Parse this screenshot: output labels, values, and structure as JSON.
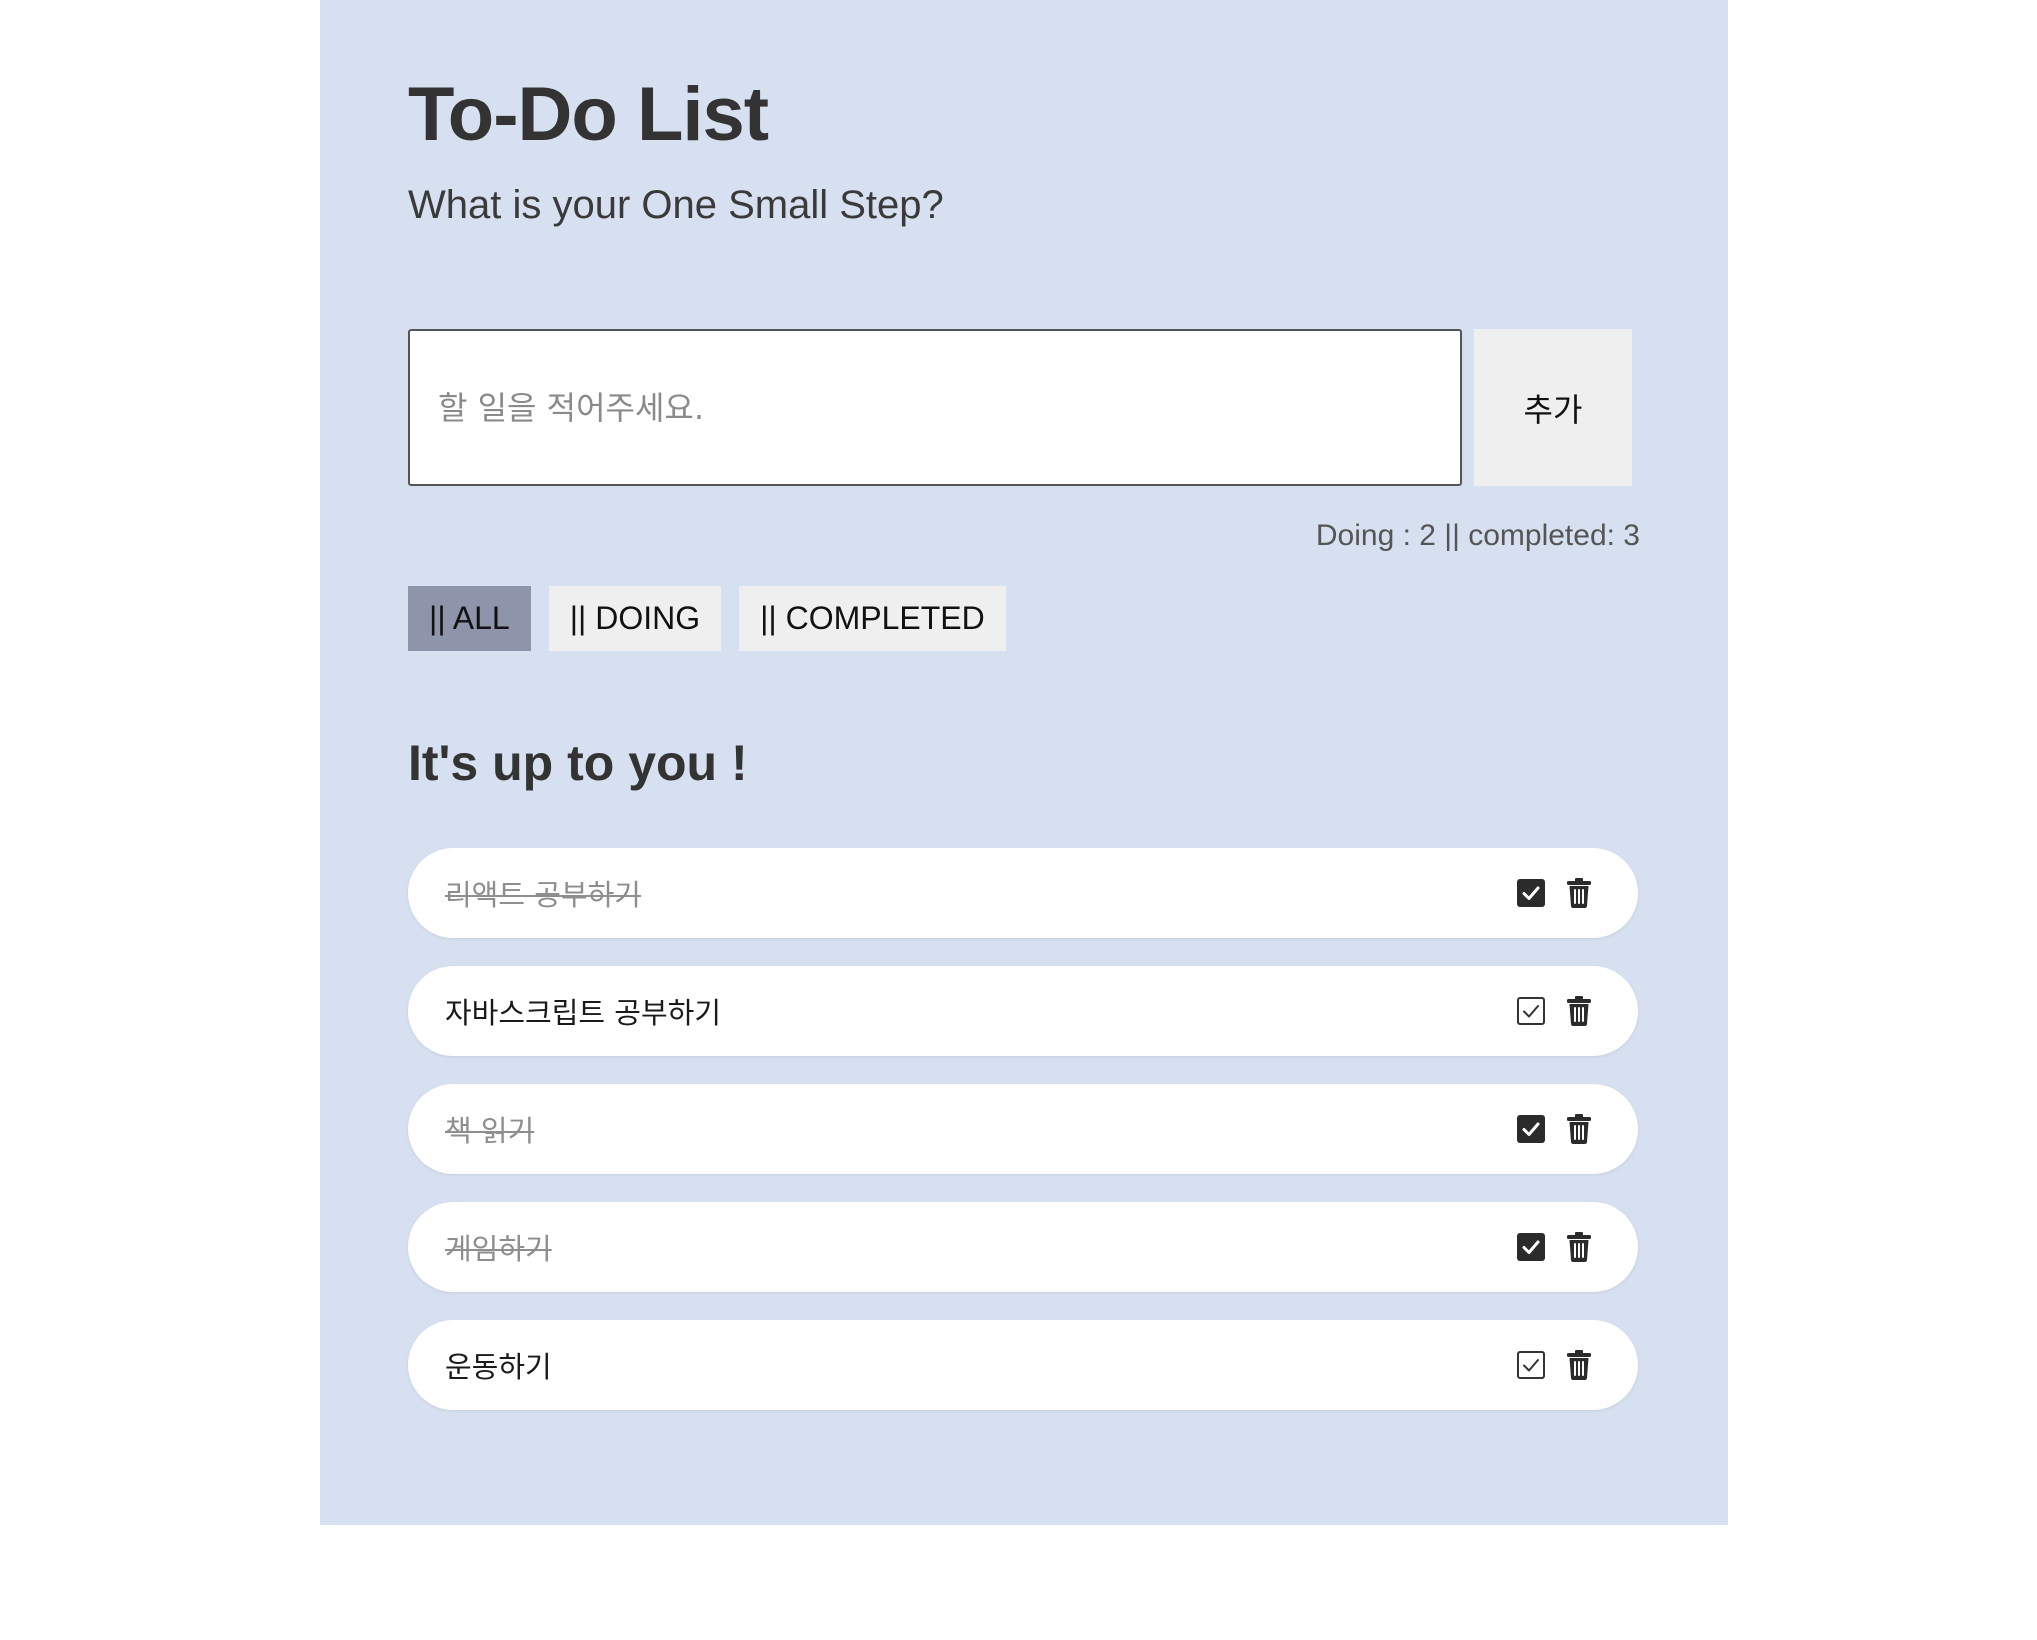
{
  "header": {
    "title": "To-Do List",
    "subtitle": "What is your One Small Step?"
  },
  "input": {
    "value": "",
    "placeholder": "할 일을 적어주세요.",
    "add_label": "추가"
  },
  "counts": {
    "text": "Doing : 2 || completed: 3"
  },
  "filters": [
    {
      "label": "|| ALL",
      "active": true
    },
    {
      "label": "|| DOING",
      "active": false
    },
    {
      "label": "|| COMPLETED",
      "active": false
    }
  ],
  "section": {
    "heading": "It's up to you !"
  },
  "todos": [
    {
      "text": "리액트 공부하기",
      "completed": true
    },
    {
      "text": "자바스크립트 공부하기",
      "completed": false
    },
    {
      "text": "책 읽기",
      "completed": true
    },
    {
      "text": "게임하기",
      "completed": true
    },
    {
      "text": "운동하기",
      "completed": false
    }
  ],
  "icons": {
    "checked": "checkbox-checked-icon",
    "unchecked": "checkbox-unchecked-icon",
    "delete": "trash-icon"
  },
  "colors": {
    "panel_bg": "#d7e0f0",
    "active_filter": "#8e95ab",
    "button_bg": "#efefef",
    "text_dark": "#333333"
  }
}
